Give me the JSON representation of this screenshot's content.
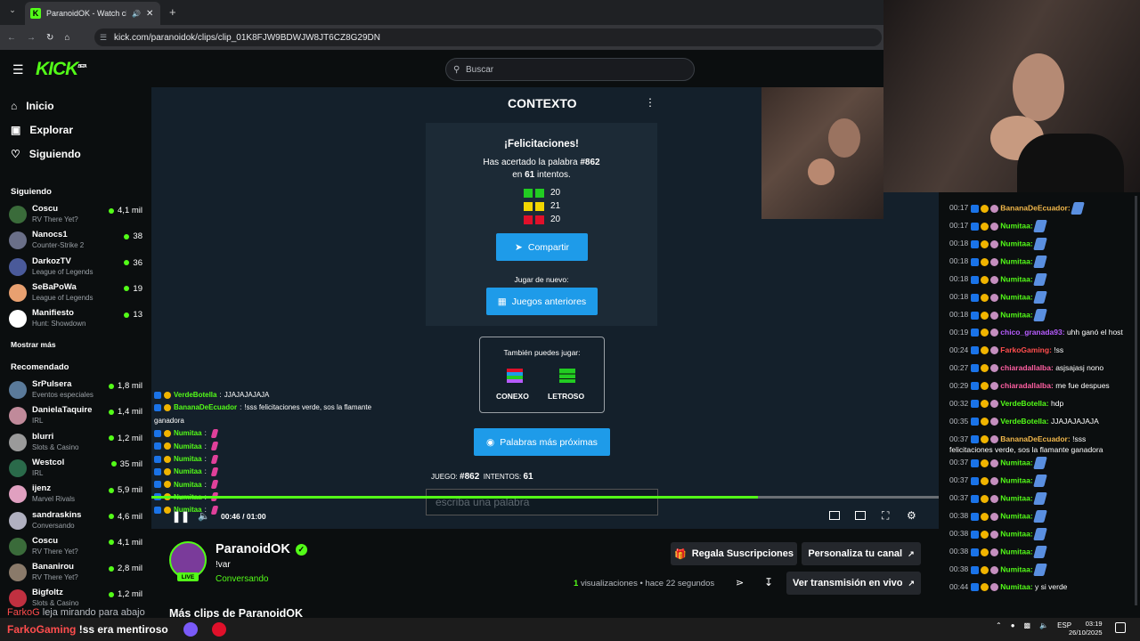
{
  "browser": {
    "tab_title": "ParanoidOK - Watch clips c",
    "url": "kick.com/paranoidok/clips/clip_01K8FJW9BDWJW8JT6CZ8G29DN"
  },
  "header": {
    "logo": "KICK",
    "logo_beta": "BETA",
    "search_placeholder": "Buscar"
  },
  "sidebar": {
    "nav": [
      "Inicio",
      "Explorar",
      "Siguiendo"
    ],
    "following_title": "Siguiendo",
    "following": [
      {
        "name": "Coscu",
        "game": "RV There Yet?",
        "viewers": "4,1 mil",
        "color": "#3a6b3a"
      },
      {
        "name": "Nanocs1",
        "game": "Counter-Strike 2",
        "viewers": "38",
        "color": "#6a6f88"
      },
      {
        "name": "DarkozTV",
        "game": "League of Legends",
        "viewers": "36",
        "color": "#4a5a9a"
      },
      {
        "name": "SeBaPoWa",
        "game": "League of Legends",
        "viewers": "19",
        "color": "#e8a070"
      },
      {
        "name": "Manifiesto",
        "game": "Hunt: Showdown",
        "viewers": "13",
        "color": "#ffffff"
      }
    ],
    "show_more": "Mostrar más",
    "recommended_title": "Recomendado",
    "recommended": [
      {
        "name": "SrPulsera",
        "game": "Eventos especiales",
        "viewers": "1,8 mil",
        "color": "#5a7a9a"
      },
      {
        "name": "DanielaTaquire",
        "game": "IRL",
        "viewers": "1,4 mil",
        "color": "#c08a9a"
      },
      {
        "name": "blurri",
        "game": "Slots & Casino",
        "viewers": "1,2 mil",
        "color": "#9a9a9a"
      },
      {
        "name": "Westcol",
        "game": "IRL",
        "viewers": "35 mil",
        "color": "#2a6a4a"
      },
      {
        "name": "ijenz",
        "game": "Marvel Rivals",
        "viewers": "5,9 mil",
        "color": "#e0a0c0"
      },
      {
        "name": "sandraskins",
        "game": "Conversando",
        "viewers": "4,6 mil",
        "color": "#b0b0c0"
      },
      {
        "name": "Coscu",
        "game": "RV There Yet?",
        "viewers": "4,1 mil",
        "color": "#3a6b3a"
      },
      {
        "name": "Bananirou",
        "game": "RV There Yet?",
        "viewers": "2,8 mil",
        "color": "#8a7a6a"
      },
      {
        "name": "Bigfoltz",
        "game": "Slots & Casino",
        "viewers": "1,2 mil",
        "color": "#c03040"
      }
    ]
  },
  "video": {
    "context_title": "CONTEXTO",
    "congrats": "¡Felicitaciones!",
    "guessed_line": "Has acertado la palabra",
    "word_number": "#862",
    "attempts_prefix": "en",
    "attempts": "61",
    "attempts_suffix": "intentos.",
    "stats": [
      {
        "value": "20",
        "color": "#22cc22"
      },
      {
        "value": "21",
        "color": "#f2d600"
      },
      {
        "value": "20",
        "color": "#e0102a"
      }
    ],
    "share_label": "Compartir",
    "play_again": "Jugar de nuevo:",
    "previous_games": "Juegos anteriores",
    "also_play": "También puedes jugar:",
    "game1": "CONEXO",
    "game2": "LETROSO",
    "closest_words": "Palabras más próximas",
    "game_label": "JUEGO:",
    "game_value": "#862",
    "attempts_label": "INTENTOS:",
    "attempts_value": "61",
    "input_placeholder": "escriba una palabra",
    "time_current": "00:46",
    "time_sep": "/",
    "time_total": "01:00",
    "progress": 0.77,
    "overlay_chat": [
      {
        "user": "VerdeBotella",
        "text": "JJAJAJAJAJA",
        "color": "#53fc18"
      },
      {
        "user": "BananaDeEcuador",
        "text": "!sss felicitaciones verde, sos la flamante",
        "color": "#53fc18"
      },
      {
        "user": "",
        "text": "ganadora",
        "color": ""
      },
      {
        "user": "Numitaa",
        "text": "",
        "color": "#53fc18"
      },
      {
        "user": "Numitaa",
        "text": "",
        "color": "#53fc18"
      },
      {
        "user": "Numitaa",
        "text": "",
        "color": "#53fc18"
      },
      {
        "user": "Numitaa",
        "text": "",
        "color": "#53fc18"
      },
      {
        "user": "Numitaa",
        "text": "",
        "color": "#53fc18"
      },
      {
        "user": "Numitaa",
        "text": "",
        "color": "#53fc18"
      },
      {
        "user": "Numitaa",
        "text": "",
        "color": "#53fc18"
      }
    ]
  },
  "chat": [
    {
      "t": "00:17",
      "user": "BananaDeEcuador:",
      "text": "",
      "color": "#f2b84b"
    },
    {
      "t": "00:17",
      "user": "Numitaa:",
      "text": "",
      "color": "#53fc18"
    },
    {
      "t": "00:18",
      "user": "Numitaa:",
      "text": "",
      "color": "#53fc18"
    },
    {
      "t": "00:18",
      "user": "Numitaa:",
      "text": "",
      "color": "#53fc18"
    },
    {
      "t": "00:18",
      "user": "Numitaa:",
      "text": "",
      "color": "#53fc18"
    },
    {
      "t": "00:18",
      "user": "Numitaa:",
      "text": "",
      "color": "#53fc18"
    },
    {
      "t": "00:18",
      "user": "Numitaa:",
      "text": "",
      "color": "#53fc18"
    },
    {
      "t": "00:19",
      "user": "chico_granada93:",
      "text": "uhh ganó el host",
      "color": "#b75cff"
    },
    {
      "t": "00:24",
      "user": "FarkoGaming:",
      "text": "!ss",
      "color": "#ff4d4d"
    },
    {
      "t": "00:27",
      "user": "chiaradallalba:",
      "text": "asjsajasj nono",
      "color": "#ff5fa2"
    },
    {
      "t": "00:29",
      "user": "chiaradallalba:",
      "text": "me fue despues",
      "color": "#ff5fa2"
    },
    {
      "t": "00:32",
      "user": "VerdeBotella:",
      "text": "hdp",
      "color": "#53fc18"
    },
    {
      "t": "00:35",
      "user": "VerdeBotella:",
      "text": "JJAJAJAJAJA",
      "color": "#53fc18"
    },
    {
      "t": "00:37",
      "user": "BananaDeEcuador:",
      "text": "!sss felicitaciones verde, sos la flamante ganadora",
      "color": "#f2b84b"
    },
    {
      "t": "00:37",
      "user": "Numitaa:",
      "text": "",
      "color": "#53fc18"
    },
    {
      "t": "00:37",
      "user": "Numitaa:",
      "text": "",
      "color": "#53fc18"
    },
    {
      "t": "00:37",
      "user": "Numitaa:",
      "text": "",
      "color": "#53fc18"
    },
    {
      "t": "00:38",
      "user": "Numitaa:",
      "text": "",
      "color": "#53fc18"
    },
    {
      "t": "00:38",
      "user": "Numitaa:",
      "text": "",
      "color": "#53fc18"
    },
    {
      "t": "00:38",
      "user": "Numitaa:",
      "text": "",
      "color": "#53fc18"
    },
    {
      "t": "00:38",
      "user": "Numitaa:",
      "text": "",
      "color": "#53fc18"
    },
    {
      "t": "00:44",
      "user": "Numitaa:",
      "text": "y si verde",
      "color": "#53fc18"
    }
  ],
  "info": {
    "streamer": "ParanoidOK",
    "live": "LIVE",
    "title": "!var",
    "category": "Conversando",
    "views_count": "1",
    "views_label": "visualizaciones",
    "ago": "hace 22 segundos",
    "gift_subs": "Regala Suscripciones",
    "customize": "Personaliza tu canal",
    "watch_live": "Ver transmisión en vivo",
    "more_clips": "Más clips de ParanoidOK"
  },
  "bottom_overlay": {
    "line1": "leja mirando para abajo",
    "line2": "!ss era mentiroso",
    "user": "FarkoGaming"
  },
  "taskbar": {
    "lang": "ESP",
    "time": "03:19",
    "date": "26/10/2025"
  }
}
